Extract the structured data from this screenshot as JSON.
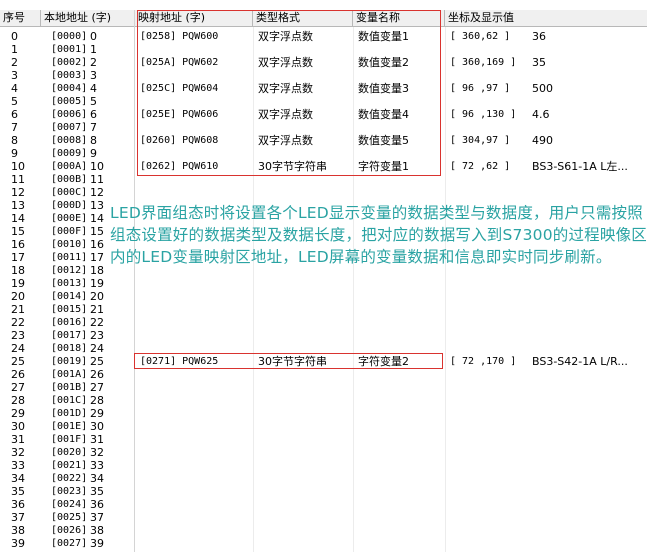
{
  "headers": {
    "index": "序号",
    "local_addr": "本地地址 (字)",
    "mapped_addr": "映射地址 (字)",
    "type": "类型格式",
    "var_name": "变量名称",
    "coords": "坐标及显示值"
  },
  "left_rows": [
    {
      "idx": "0",
      "addr": "[0000]",
      "n": "0"
    },
    {
      "idx": "1",
      "addr": "[0001]",
      "n": "1"
    },
    {
      "idx": "2",
      "addr": "[0002]",
      "n": "2"
    },
    {
      "idx": "3",
      "addr": "[0003]",
      "n": "3"
    },
    {
      "idx": "4",
      "addr": "[0004]",
      "n": "4"
    },
    {
      "idx": "5",
      "addr": "[0005]",
      "n": "5"
    },
    {
      "idx": "6",
      "addr": "[0006]",
      "n": "6"
    },
    {
      "idx": "7",
      "addr": "[0007]",
      "n": "7"
    },
    {
      "idx": "8",
      "addr": "[0008]",
      "n": "8"
    },
    {
      "idx": "9",
      "addr": "[0009]",
      "n": "9"
    },
    {
      "idx": "10",
      "addr": "[000A]",
      "n": "10"
    },
    {
      "idx": "11",
      "addr": "[000B]",
      "n": "11"
    },
    {
      "idx": "12",
      "addr": "[000C]",
      "n": "12"
    },
    {
      "idx": "13",
      "addr": "[000D]",
      "n": "13"
    },
    {
      "idx": "14",
      "addr": "[000E]",
      "n": "14"
    },
    {
      "idx": "15",
      "addr": "[000F]",
      "n": "15"
    },
    {
      "idx": "16",
      "addr": "[0010]",
      "n": "16"
    },
    {
      "idx": "17",
      "addr": "[0011]",
      "n": "17"
    },
    {
      "idx": "18",
      "addr": "[0012]",
      "n": "18"
    },
    {
      "idx": "19",
      "addr": "[0013]",
      "n": "19"
    },
    {
      "idx": "20",
      "addr": "[0014]",
      "n": "20"
    },
    {
      "idx": "21",
      "addr": "[0015]",
      "n": "21"
    },
    {
      "idx": "22",
      "addr": "[0016]",
      "n": "22"
    },
    {
      "idx": "23",
      "addr": "[0017]",
      "n": "23"
    },
    {
      "idx": "24",
      "addr": "[0018]",
      "n": "24"
    },
    {
      "idx": "25",
      "addr": "[0019]",
      "n": "25"
    },
    {
      "idx": "26",
      "addr": "[001A]",
      "n": "26"
    },
    {
      "idx": "27",
      "addr": "[001B]",
      "n": "27"
    },
    {
      "idx": "28",
      "addr": "[001C]",
      "n": "28"
    },
    {
      "idx": "29",
      "addr": "[001D]",
      "n": "29"
    },
    {
      "idx": "30",
      "addr": "[001E]",
      "n": "30"
    },
    {
      "idx": "31",
      "addr": "[001F]",
      "n": "31"
    },
    {
      "idx": "32",
      "addr": "[0020]",
      "n": "32"
    },
    {
      "idx": "33",
      "addr": "[0021]",
      "n": "33"
    },
    {
      "idx": "34",
      "addr": "[0022]",
      "n": "34"
    },
    {
      "idx": "35",
      "addr": "[0023]",
      "n": "35"
    },
    {
      "idx": "36",
      "addr": "[0024]",
      "n": "36"
    },
    {
      "idx": "37",
      "addr": "[0025]",
      "n": "37"
    },
    {
      "idx": "38",
      "addr": "[0026]",
      "n": "38"
    },
    {
      "idx": "39",
      "addr": "[0027]",
      "n": "39"
    }
  ],
  "mapped_rows": [
    {
      "row": 0,
      "mapped": "[0258] PQW600",
      "type": "双字浮点数",
      "name": "数值变量1",
      "coord": "[ 360,62  ]",
      "value": "36"
    },
    {
      "row": 2,
      "mapped": "[025A] PQW602",
      "type": "双字浮点数",
      "name": "数值变量2",
      "coord": "[ 360,169 ]",
      "value": "35"
    },
    {
      "row": 4,
      "mapped": "[025C] PQW604",
      "type": "双字浮点数",
      "name": "数值变量3",
      "coord": "[ 96 ,97  ]",
      "value": "500"
    },
    {
      "row": 6,
      "mapped": "[025E] PQW606",
      "type": "双字浮点数",
      "name": "数值变量4",
      "coord": "[ 96 ,130 ]",
      "value": "4.6"
    },
    {
      "row": 8,
      "mapped": "[0260] PQW608",
      "type": "双字浮点数",
      "name": "数值变量5",
      "coord": "[ 304,97  ]",
      "value": "490"
    },
    {
      "row": 10,
      "mapped": "[0262] PQW610",
      "type": "30字节字符串",
      "name": "字符变量1",
      "coord": "[ 72 ,62  ]",
      "value": "BS3-S61-1A L左..."
    },
    {
      "row": 25,
      "mapped": "[0271] PQW625",
      "type": "30字节字符串",
      "name": "字符变量2",
      "coord": "[ 72 ,170 ]",
      "value": "BS3-S42-1A L/R..."
    }
  ],
  "annotation": "LED界面组态时将设置各个LED显示变量的数据类型与数据度，用户只需按照组态设置好的数据类型及数据长度，把对应的数据写入到S7300的过程映像区内的LED变量映射区地址，LED屏幕的变量数据和信息即实时同步刷新。",
  "colors": {
    "highlight_box": "#d9332f",
    "annotation_text": "#2aa3a3",
    "header_bg": "#f0f0f0"
  }
}
